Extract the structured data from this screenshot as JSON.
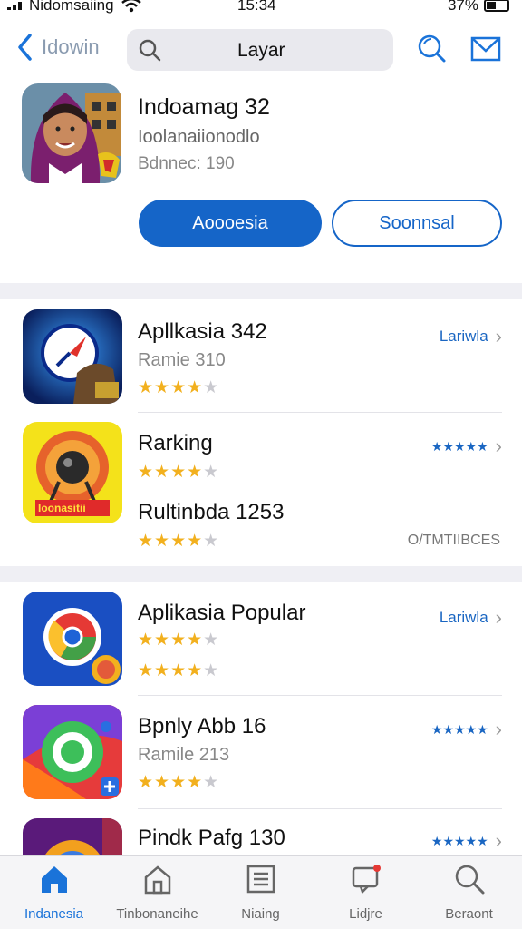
{
  "status_bar": {
    "carrier": "Nidomsaiing",
    "time": "15:34",
    "battery": "37%"
  },
  "nav": {
    "back_label": "Idowin",
    "search_text": "Layar"
  },
  "hero": {
    "title": "Indoamag 32",
    "subtitle": "Ioolanaiionodlo",
    "meta": "Bdnnec: 190",
    "primary_button": "Aoooesia",
    "secondary_button": "Soonnsal"
  },
  "section1": {
    "rows": [
      {
        "name": "Apllkasia 342",
        "sub": "Ramie 310",
        "rating": 4,
        "action": "Lariwla",
        "icon": "compass-app-icon"
      },
      {
        "name": "Rarking",
        "rating": 4,
        "second_name": "Rultinbda 1253",
        "second_rating": 4,
        "icon_label": "Ioonasitii",
        "action": "★★★★★",
        "tag": "O/TMTIIBCES",
        "icon": "speaker-app-icon"
      }
    ]
  },
  "section2": {
    "rows": [
      {
        "name": "Aplikasia Popular",
        "rating": 4,
        "second_rating": 4,
        "action": "Lariwla",
        "icon": "chrome-like-app-icon"
      },
      {
        "name": "Bpnly Abb 16",
        "sub": "Ramile 213",
        "rating": 4,
        "action": "★★★★★",
        "icon": "camera-app-icon"
      },
      {
        "name": "Pindk Pafg 130",
        "action": "★★★★★",
        "icon": "colorful-app-icon"
      }
    ]
  },
  "tabs": [
    {
      "label": "Indanesia",
      "icon": "home-icon",
      "active": true
    },
    {
      "label": "Tinbonaneihe",
      "icon": "building-icon",
      "active": false
    },
    {
      "label": "Niaing",
      "icon": "list-icon",
      "active": false
    },
    {
      "label": "Lidjre",
      "icon": "chat-icon",
      "active": false
    },
    {
      "label": "Beraont",
      "icon": "search-icon",
      "active": false
    }
  ],
  "colors": {
    "accent": "#1565c8",
    "star": "#f2b01e"
  }
}
